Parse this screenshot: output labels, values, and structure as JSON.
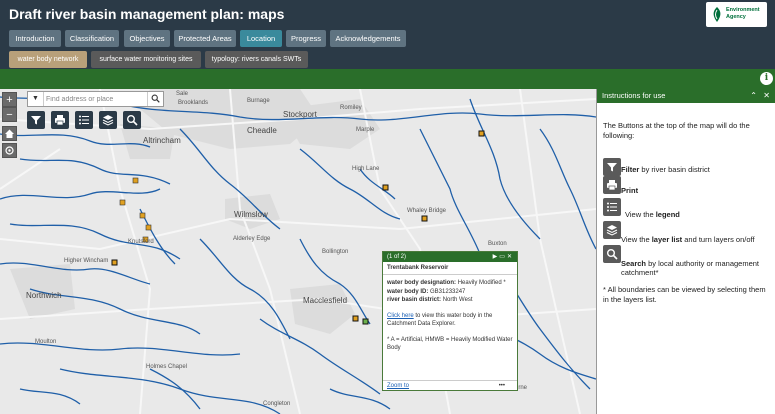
{
  "app": {
    "title": "Draft river basin management plan: maps",
    "logo_text": [
      "Environment",
      "Agency"
    ]
  },
  "tabs": [
    {
      "label": "Introduction",
      "active": false
    },
    {
      "label": "Classification",
      "active": false
    },
    {
      "label": "Objectives",
      "active": false
    },
    {
      "label": "Protected Areas",
      "active": false
    },
    {
      "label": "Location",
      "active": true
    },
    {
      "label": "Progress",
      "active": false
    },
    {
      "label": "Acknowledgements",
      "active": false
    }
  ],
  "subtabs": [
    {
      "label": "water body network",
      "active": true
    },
    {
      "label": "surface water monitoring sites",
      "active": false
    },
    {
      "label": "typology: rivers canals SWTs",
      "active": false
    }
  ],
  "map": {
    "zoom_in": "+",
    "zoom_out": "−",
    "search_placeholder": "Find address or place",
    "towns": [
      "Sale",
      "Brooklands",
      "Burnage",
      "Romiley",
      "Stockport",
      "Marple",
      "Cheadle",
      "Altrincham",
      "High Lane",
      "Knutsford",
      "Wilmslow",
      "Alderley Edge",
      "Whaley Bridge",
      "Higher Wincham",
      "Northwich",
      "Macclesfield",
      "Moulton",
      "Holmes Chapel",
      "Buxton",
      "Ashbourne",
      "Congleton",
      "Bollington"
    ]
  },
  "popup": {
    "counter": "(1 of 2)",
    "title": "Trentabank Reservoir",
    "designation_label": "water body designation:",
    "designation_value": "Heavily Modified *",
    "id_label": "water body ID:",
    "id_value": "GB31233247",
    "district_label": "river basin district:",
    "district_value": "North West",
    "link_text": "Click here",
    "link_rest": " to view this water body in the Catchment Data Explorer.",
    "footnote": "* A = Artificial, HMWB = Heavily Modified Water Body",
    "zoom_to": "Zoom to",
    "more": "•••"
  },
  "instructions": {
    "title": "Instructions for use",
    "intro": "The Buttons at the top of the map will do the following:",
    "items": [
      {
        "icon": "filter-icon",
        "bold": "Filter",
        "rest": " by river basin district"
      },
      {
        "icon": "print-icon",
        "bold": "Print",
        "rest": ""
      },
      {
        "icon": "legend-icon",
        "pre": "View the ",
        "bold": "legend",
        "rest": ""
      },
      {
        "icon": "layers-icon",
        "pre": "View the ",
        "bold": "layer list",
        "rest": " and turn layers on/off"
      },
      {
        "icon": "search-icon",
        "bold": "Search",
        "rest": " by local authority or management catchment*"
      }
    ],
    "note": "* All boundaries can be viewed by selecting them in the layers list."
  },
  "colors": {
    "header_bg": "#2b3a47",
    "tab_bg": "#5f7381",
    "tab_active": "#3a8a9c",
    "subtab_active": "#b8a07a",
    "green": "#2a6e2a",
    "river": "#1f5fa8"
  }
}
